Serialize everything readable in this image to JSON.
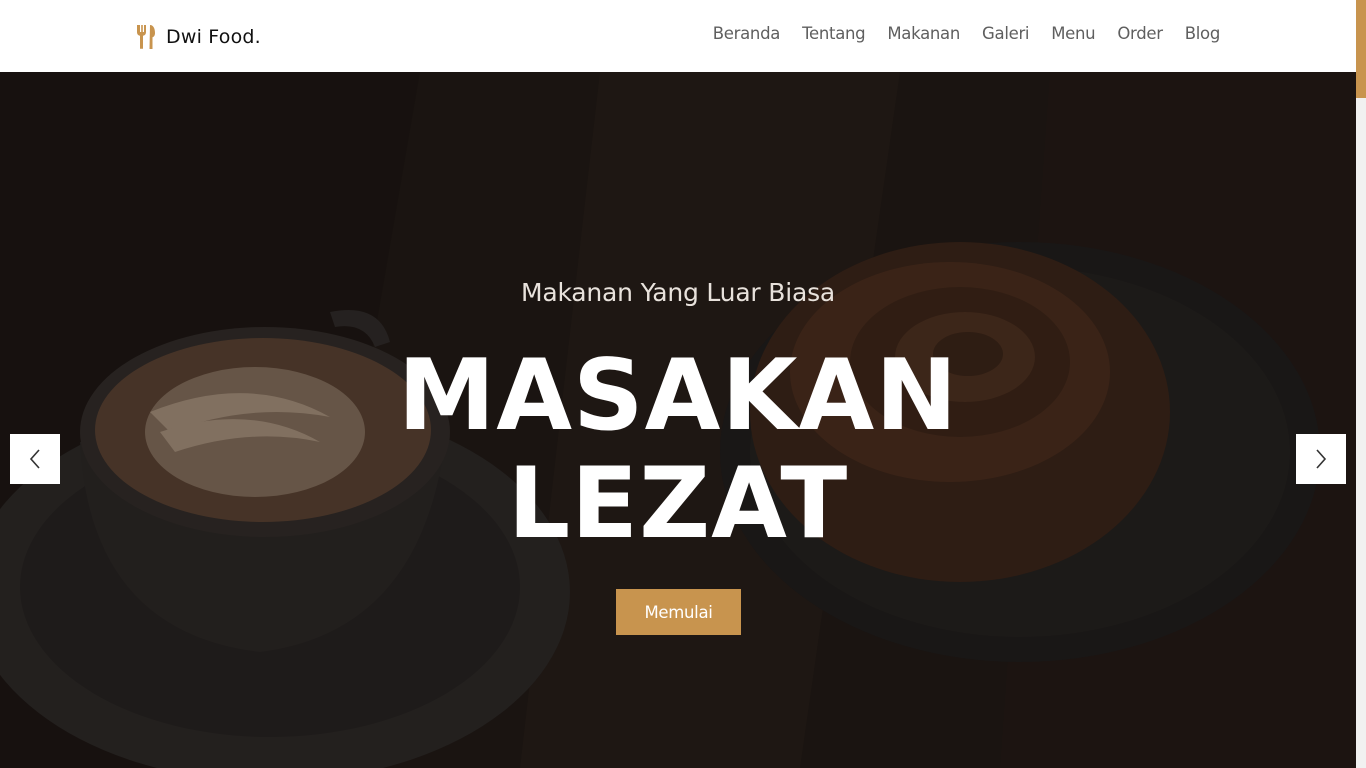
{
  "header": {
    "brand": "Dwi Food.",
    "logo_icon": "fork-knife-icon",
    "nav": [
      "Beranda",
      "Tentang",
      "Makanan",
      "Galeri",
      "Menu",
      "Order",
      "Blog"
    ]
  },
  "hero": {
    "subtitle": "Makanan Yang Luar Biasa",
    "title_line1": "MASAKAN",
    "title_line2": "LEZAT",
    "cta_label": "Memulai",
    "prev_icon": "chevron-left-icon",
    "next_icon": "chevron-right-icon"
  },
  "colors": {
    "accent": "#c8944e",
    "header_bg": "#ffffff",
    "nav_text": "#5f5f5f"
  }
}
